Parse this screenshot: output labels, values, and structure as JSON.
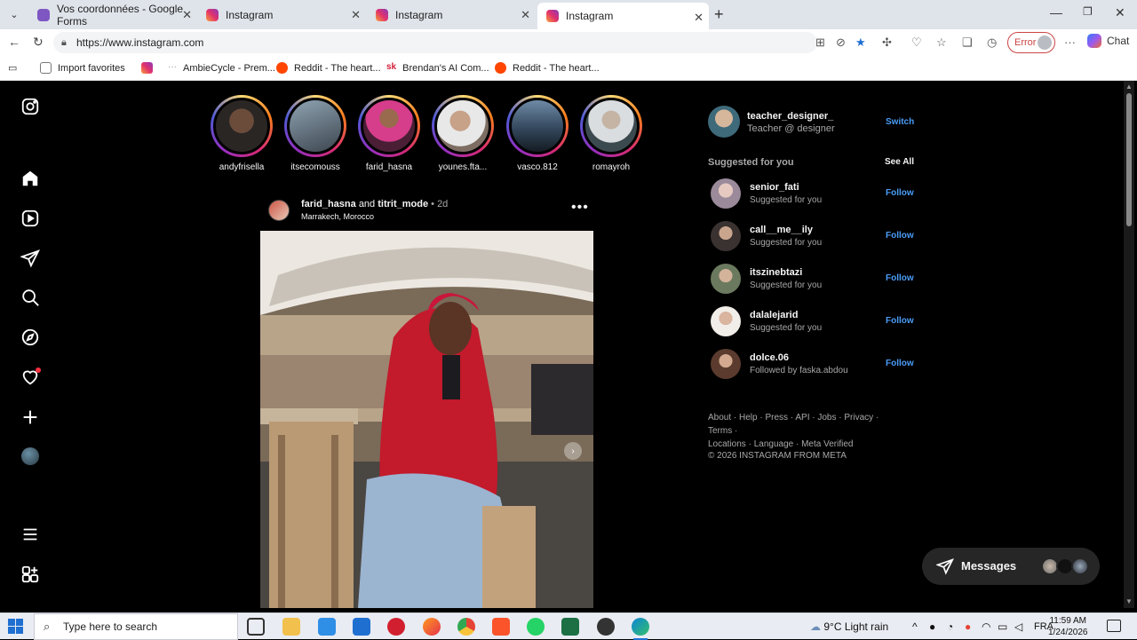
{
  "browser": {
    "tabs": [
      {
        "title": "Vos coordonnées - Google Forms",
        "favicon": "google-forms-icon"
      },
      {
        "title": "Instagram",
        "favicon": "instagram-icon"
      },
      {
        "title": "Instagram",
        "favicon": "instagram-icon"
      },
      {
        "title": "Instagram",
        "favicon": "instagram-icon",
        "active": true
      }
    ],
    "url": "https://www.instagram.com",
    "error_label": "Error",
    "chat_label": "Chat",
    "bookmarks": [
      {
        "label": "Import favorites",
        "icon": "import-icon"
      },
      {
        "label": "",
        "icon": "instagram-icon"
      },
      {
        "label": "AmbieCycle - Prem...",
        "icon": "ambiecycle-icon"
      },
      {
        "label": "Reddit - The heart...",
        "icon": "reddit-icon"
      },
      {
        "label": "Brendan's AI Com...",
        "icon": "sk-icon"
      },
      {
        "label": "Reddit - The heart...",
        "icon": "reddit-icon"
      }
    ]
  },
  "stories": [
    {
      "username": "andyfrisella"
    },
    {
      "username": "itsecomouss"
    },
    {
      "username": "farid_hasna"
    },
    {
      "username": "younes.fta..."
    },
    {
      "username": "vasco.812"
    },
    {
      "username": "romayroh"
    }
  ],
  "post": {
    "author": "farid_hasna",
    "connector": "and",
    "coauthor": "titrit_mode",
    "dot": "•",
    "age": "2d",
    "location": "Marrakech, Morocco",
    "more": "•••"
  },
  "profile": {
    "username": "teacher_designer_",
    "full_name": "Teacher @ designer",
    "switch_label": "Switch"
  },
  "suggestions": {
    "title": "Suggested for you",
    "see_all": "See All",
    "items": [
      {
        "username": "senior_fati",
        "subtitle": "Suggested for you",
        "action": "Follow"
      },
      {
        "username": "call__me__ily",
        "subtitle": "Suggested for you",
        "action": "Follow"
      },
      {
        "username": "itszinebtazi",
        "subtitle": "Suggested for you",
        "action": "Follow"
      },
      {
        "username": "dalalejarid",
        "subtitle": "Suggested for you",
        "action": "Follow"
      },
      {
        "username": "dolce.06",
        "subtitle": "Followed by faska.abdou",
        "action": "Follow"
      }
    ]
  },
  "footer": {
    "links_line1": "About · Help · Press · API · Jobs · Privacy · Terms ·",
    "links_line2": "Locations · Language · Meta Verified",
    "copyright": "© 2026 INSTAGRAM FROM META"
  },
  "messages": {
    "label": "Messages"
  },
  "taskbar": {
    "search_placeholder": "Type here to search",
    "weather": "9°C  Light rain",
    "language": "FRA",
    "time": "11:59 AM",
    "date": "1/24/2026"
  },
  "colors": {
    "accent_link": "#4a9df8",
    "background": "#000000",
    "text": "#f5f5f5",
    "muted": "#a8a8a8"
  }
}
